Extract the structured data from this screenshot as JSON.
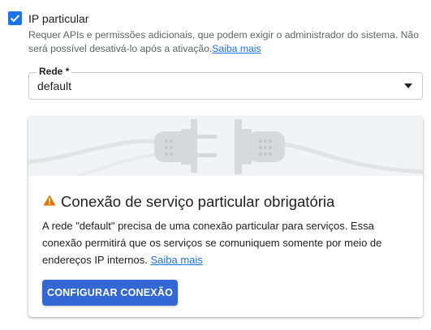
{
  "checkbox": {
    "checked": true,
    "label": "IP particular",
    "helper_text": "Requer APIs e permissões adicionais, que podem exigir o administrador do sistema. Não será possível desativá-lo após a ativação.",
    "helper_link": "Saiba mais"
  },
  "network_select": {
    "label": "Rede *",
    "value": "default"
  },
  "card": {
    "title": "Conexão de serviço particular obrigatória",
    "body_text": "A rede \"default\" precisa de uma conexão particular para serviços. Essa conexão permitirá que os serviços se comuniquem somente por meio de endereços IP internos.",
    "body_link": "Saiba mais",
    "button_label": "CONFIGURAR CONEXÃO",
    "warning_icon": "warning-icon",
    "illustration": "plug-icon"
  },
  "colors": {
    "accent": "#1a73e8",
    "button": "#3367d6",
    "warning": "#e37400"
  }
}
